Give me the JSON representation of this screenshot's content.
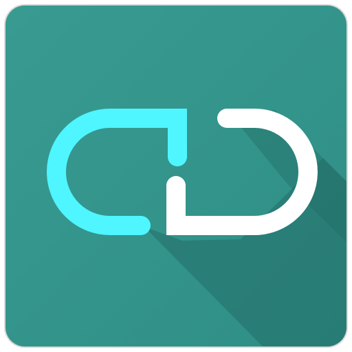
{
  "app_icon": {
    "icon": "link-icon",
    "colors": {
      "background": "#2f8f86",
      "background_light": "#389a91",
      "shadow": "#226e67",
      "left_link": "#4ff5ff",
      "right_link": "#ffffff",
      "border": "#d9d9d9"
    }
  }
}
